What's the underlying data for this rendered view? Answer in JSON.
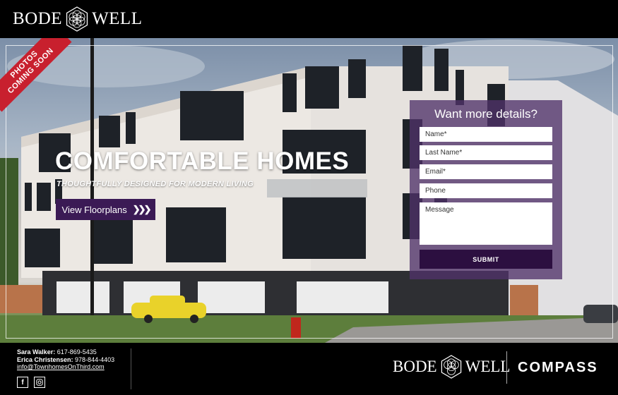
{
  "brand": {
    "name_left": "BODE",
    "name_right": "WELL"
  },
  "ribbon": {
    "line1": "PHOTOS",
    "line2": "COMING SOON"
  },
  "hero": {
    "headline": "COMFORTABLE HOMES",
    "subheadline": "THOUGHTFULLY DESIGNED FOR MODERN LIVING",
    "cta_label": "View Floorplans",
    "cta_icon": "double-chevron-right-icon"
  },
  "form": {
    "title": "Want more details?",
    "fields": {
      "name": "Name*",
      "last_name": "Last Name*",
      "email": "Email*",
      "phone": "Phone",
      "message": "Message"
    },
    "submit_label": "SUBMIT"
  },
  "footer": {
    "contact1_name": "Sara Walker:",
    "contact1_phone": "617-869-5435",
    "contact2_name": "Erica Christensen:",
    "contact2_phone": "978-844-4403",
    "email": "info@TownhomesOnThird.com",
    "social": [
      "facebook-icon",
      "instagram-icon"
    ],
    "partner": "COMPASS"
  },
  "colors": {
    "accent": "#3b1a55",
    "submit": "#2c0f40",
    "ribbon": "#c8202e"
  }
}
